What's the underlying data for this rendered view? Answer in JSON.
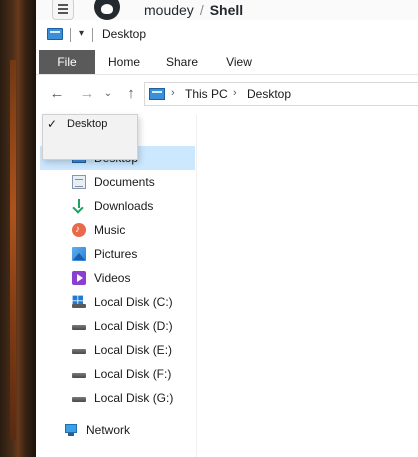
{
  "browser_header": {
    "owner": "moudey",
    "separator": "/",
    "repo": "Shell"
  },
  "window": {
    "title": "Desktop"
  },
  "ribbon": {
    "tabs": [
      "File",
      "Home",
      "Share",
      "View"
    ],
    "active": "File"
  },
  "address": {
    "segments": [
      "This PC",
      "Desktop"
    ]
  },
  "dropdown": {
    "items": [
      {
        "label": "Desktop",
        "checked": true
      }
    ]
  },
  "nav_pane": {
    "selected": "Desktop",
    "items": [
      {
        "label": "Desktop",
        "icon": "desktop-icon"
      },
      {
        "label": "Documents",
        "icon": "documents-icon"
      },
      {
        "label": "Downloads",
        "icon": "downloads-icon"
      },
      {
        "label": "Music",
        "icon": "music-icon"
      },
      {
        "label": "Pictures",
        "icon": "pictures-icon"
      },
      {
        "label": "Videos",
        "icon": "videos-icon"
      },
      {
        "label": "Local Disk (C:)",
        "icon": "system-disk-icon"
      },
      {
        "label": "Local Disk (D:)",
        "icon": "disk-icon"
      },
      {
        "label": "Local Disk (E:)",
        "icon": "disk-icon"
      },
      {
        "label": "Local Disk (F:)",
        "icon": "disk-icon"
      },
      {
        "label": "Local Disk (G:)",
        "icon": "disk-icon"
      }
    ],
    "network": {
      "label": "Network",
      "icon": "network-icon"
    }
  },
  "colors": {
    "selection": "#cce8ff",
    "file_tab": "#5a5a5a",
    "folder_blue": "#3b8fd9"
  }
}
